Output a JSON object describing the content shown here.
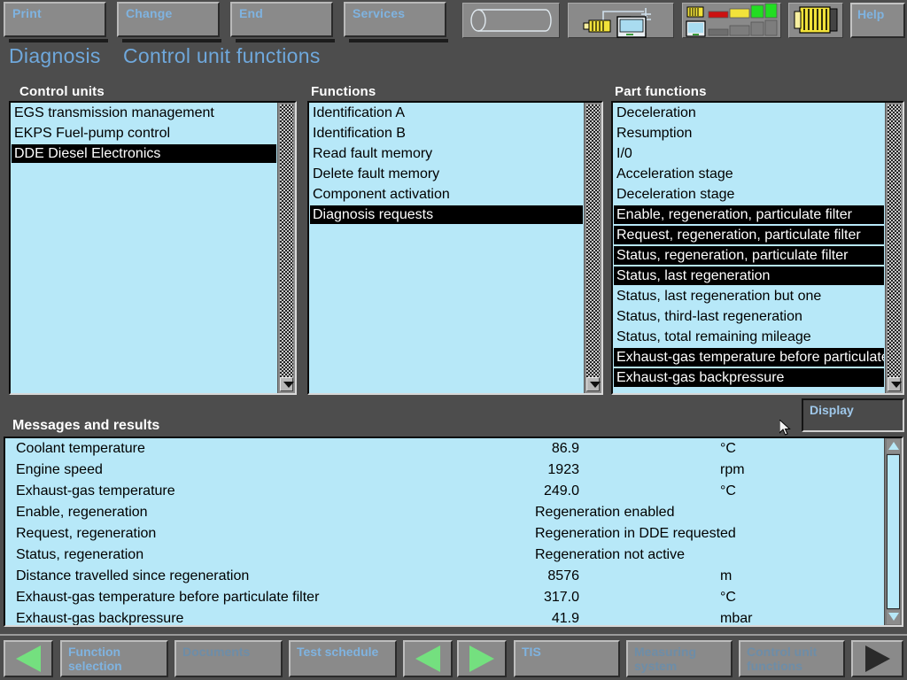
{
  "toolbar": {
    "buttons": [
      {
        "label": "Print",
        "name": "print-button"
      },
      {
        "label": "Change",
        "name": "change-button"
      },
      {
        "label": "End",
        "name": "end-button"
      },
      {
        "label": "Services",
        "name": "services-button"
      }
    ],
    "icons": [
      {
        "name": "cylinder-icon"
      },
      {
        "name": "ecu-network-icon"
      },
      {
        "name": "signal-bars-icon"
      },
      {
        "name": "ecu-module-icon"
      }
    ],
    "help_label": "Help"
  },
  "title": {
    "primary": "Diagnosis",
    "secondary": "Control unit functions",
    "color": "#6fa8dc"
  },
  "panels": {
    "control_units": {
      "header": "Control units",
      "items": [
        {
          "label": "EGS transmission management",
          "selected": false
        },
        {
          "label": "EKPS Fuel-pump control",
          "selected": false
        },
        {
          "label": "DDE Diesel Electronics",
          "selected": true
        }
      ]
    },
    "functions": {
      "header": "Functions",
      "items": [
        {
          "label": "Identification A",
          "selected": false
        },
        {
          "label": "Identification B",
          "selected": false
        },
        {
          "label": "Read fault memory",
          "selected": false
        },
        {
          "label": "Delete fault memory",
          "selected": false
        },
        {
          "label": "Component activation",
          "selected": false
        },
        {
          "label": "Diagnosis requests",
          "selected": true
        }
      ]
    },
    "part_functions": {
      "header": "Part functions",
      "items": [
        {
          "label": "Deceleration",
          "selected": false
        },
        {
          "label": "Resumption",
          "selected": false
        },
        {
          "label": "I/0",
          "selected": false
        },
        {
          "label": "Acceleration stage",
          "selected": false
        },
        {
          "label": "Deceleration stage",
          "selected": false
        },
        {
          "label": "Enable, regeneration, particulate filter",
          "selected": true
        },
        {
          "label": "Request, regeneration, particulate filter",
          "selected": true
        },
        {
          "label": "Status, regeneration, particulate filter",
          "selected": true
        },
        {
          "label": "Status, last regeneration",
          "selected": true
        },
        {
          "label": "Status, last regeneration but one",
          "selected": false
        },
        {
          "label": "Status, third-last regeneration",
          "selected": false
        },
        {
          "label": "Status, total remaining mileage",
          "selected": false
        },
        {
          "label": "Exhaust-gas temperature before particulate filter",
          "selected": true
        },
        {
          "label": "Exhaust-gas backpressure",
          "selected": true
        }
      ]
    }
  },
  "display_button": {
    "label": "Display"
  },
  "messages": {
    "header": "Messages and results",
    "rows": [
      {
        "label": "Coolant temperature",
        "value": "86.9",
        "unit": "°C",
        "numeric": true
      },
      {
        "label": "Engine speed",
        "value": "1923",
        "unit": "rpm",
        "numeric": true
      },
      {
        "label": "Exhaust-gas temperature",
        "value": "249.0",
        "unit": "°C",
        "numeric": true
      },
      {
        "label": "Enable, regeneration",
        "value": "Regeneration enabled",
        "unit": "",
        "numeric": false
      },
      {
        "label": "Request, regeneration",
        "value": "Regeneration in DDE requested",
        "unit": "",
        "numeric": false
      },
      {
        "label": "Status, regeneration",
        "value": "Regeneration not active",
        "unit": "",
        "numeric": false
      },
      {
        "label": "Distance travelled since regeneration",
        "value": "8576",
        "unit": "m",
        "numeric": true
      },
      {
        "label": "Exhaust-gas temperature before particulate filter",
        "value": "317.0",
        "unit": "°C",
        "numeric": true
      },
      {
        "label": "Exhaust-gas backpressure",
        "value": "41.9",
        "unit": "mbar",
        "numeric": true
      }
    ]
  },
  "navbar": {
    "buttons": [
      {
        "kind": "arrow-left",
        "label": "",
        "name": "nav-back-arrow",
        "dim": false
      },
      {
        "kind": "text",
        "label": "Function\nselection",
        "name": "nav-function-selection",
        "dim": false
      },
      {
        "kind": "text",
        "label": "Documents",
        "name": "nav-documents",
        "dim": true
      },
      {
        "kind": "text",
        "label": "Test schedule",
        "name": "nav-test-schedule",
        "dim": false
      },
      {
        "kind": "arrow-left",
        "label": "",
        "name": "nav-prev-arrow",
        "dim": false
      },
      {
        "kind": "arrow-right",
        "label": "",
        "name": "nav-next-arrow",
        "dim": false
      },
      {
        "kind": "text",
        "label": "TIS",
        "name": "nav-tis",
        "dim": false
      },
      {
        "kind": "text",
        "label": "Measuring\nsystem",
        "name": "nav-measuring-system",
        "dim": true
      },
      {
        "kind": "text",
        "label": "Control unit\nfunctions",
        "name": "nav-control-unit-functions",
        "dim": true
      },
      {
        "kind": "arrow-right-dark",
        "label": "",
        "name": "nav-forward-arrow",
        "dim": false
      }
    ]
  },
  "colors": {
    "background": "#4d4d4d",
    "list_background": "#b7e8f8",
    "accent_text": "#6fa8dc",
    "selection": "#000000",
    "button_face": "#8a8a8a",
    "arrow_green": "#74e07f",
    "icon_yellow": "#f5e000",
    "icon_green": "#22dd22",
    "icon_red": "#cc1111"
  }
}
